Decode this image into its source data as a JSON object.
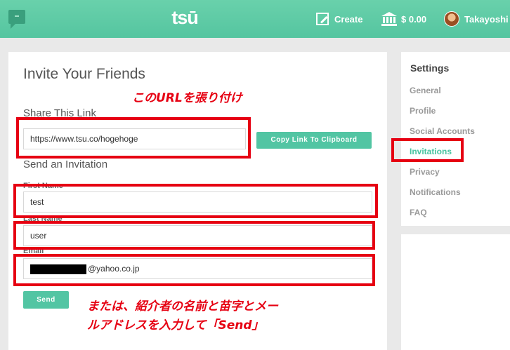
{
  "header": {
    "logo": "tsū",
    "create_label": "Create",
    "balance": "$ 0.00",
    "username": "Takayoshi"
  },
  "invite": {
    "title": "Invite Your Friends",
    "share_section": "Share This Link",
    "link_value": "https://www.tsu.co/hogehoge",
    "copy_button": "Copy Link To Clipboard",
    "send_section": "Send an Invitation",
    "first_name_label": "First Name",
    "first_name_value": "test",
    "last_name_label": "Last Name",
    "last_name_value": "user",
    "email_label": "Email",
    "email_value": "@yahoo.co.jp",
    "send_button": "Send"
  },
  "settings": {
    "title": "Settings",
    "items": [
      "General",
      "Profile",
      "Social Accounts",
      "Invitations",
      "Privacy",
      "Notifications",
      "FAQ"
    ],
    "active": "Invitations"
  },
  "annotations": {
    "note_url": "このURLを張り付け",
    "note_send_line1": "または、紹介者の名前と苗字とメー",
    "note_send_line2": "ルアドレスを入力して「Send」",
    "highlight_color": "#e60012"
  },
  "colors": {
    "header_green": "#5ccba5",
    "accent": "#52c5a3"
  }
}
